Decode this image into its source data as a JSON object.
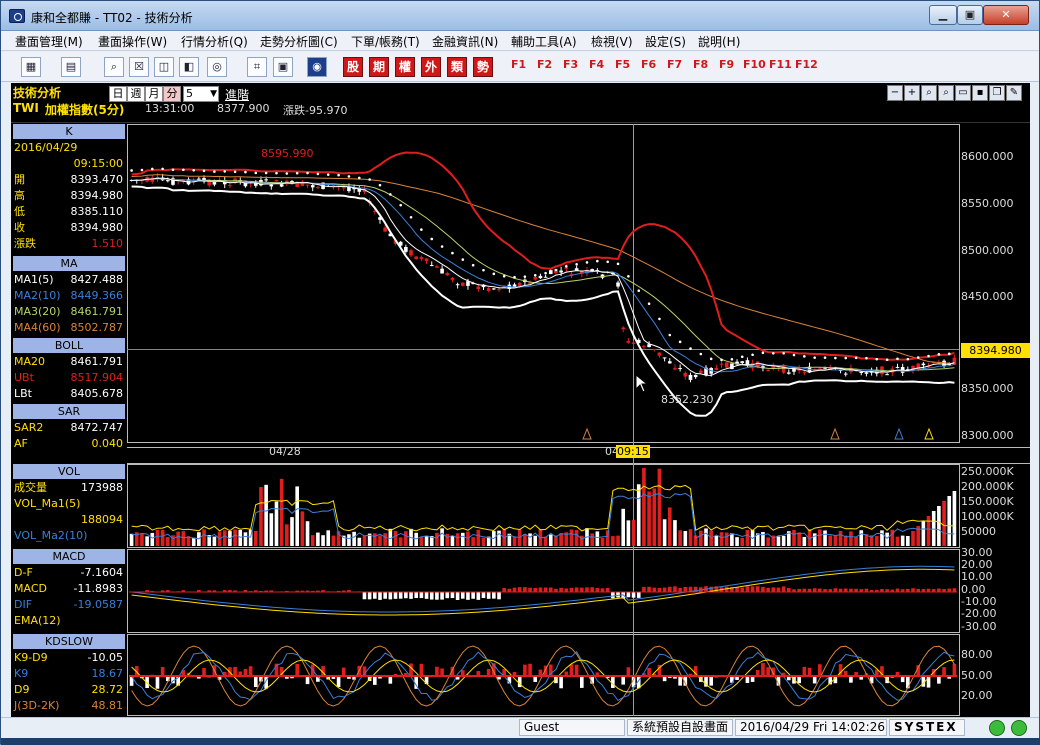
{
  "window": {
    "title": "康和全都賺 - TT02 - 技術分析",
    "minimize": "▁",
    "maximize": "▣",
    "close": "✕"
  },
  "menu": [
    "畫面管理(M)",
    "畫面操作(W)",
    "行情分析(Q)",
    "走勢分析圖(C)",
    "下單/帳務(T)",
    "金融資訊(N)",
    "輔助工具(A)",
    "檢視(V)",
    "設定(S)",
    "說明(H)"
  ],
  "toolbar": {
    "icons": [
      "layout-icon",
      "monitor-icon",
      "zoom-icon",
      "close-box-icon",
      "window-icon",
      "split-icon",
      "globe-icon",
      "link-icon",
      "screen-icon",
      "systex-icon"
    ],
    "red_buttons": [
      "股",
      "期",
      "權",
      "外",
      "類",
      "勢"
    ],
    "function_keys": [
      "F1",
      "F2",
      "F3",
      "F4",
      "F5",
      "F6",
      "F7",
      "F8",
      "F9",
      "F10",
      "F11",
      "F12"
    ]
  },
  "chart_header": {
    "section": "技術分析",
    "periods": [
      "日",
      "週",
      "月",
      "分"
    ],
    "active_period": "分",
    "interval": "5",
    "advanced": "進階",
    "symbol_code": "TWI",
    "symbol_name": "加權指數(5分)",
    "time": "13:31:00",
    "price": "8377.900",
    "change": "漲跌-95.970"
  },
  "side_panels": {
    "k": {
      "title": "K",
      "date": "2016/04/29",
      "time": "09:15:00",
      "rows": [
        {
          "k": "開",
          "v": "8393.470"
        },
        {
          "k": "高",
          "v": "8394.980"
        },
        {
          "k": "低",
          "v": "8385.110"
        },
        {
          "k": "收",
          "v": "8394.980"
        },
        {
          "k": "漲跌",
          "v": "1.510"
        }
      ]
    },
    "ma": {
      "title": "MA",
      "rows": [
        {
          "k": "MA1(5)",
          "v": "8427.488"
        },
        {
          "k": "MA2(10)",
          "v": "8449.366"
        },
        {
          "k": "MA3(20)",
          "v": "8461.791"
        },
        {
          "k": "MA4(60)",
          "v": "8502.787"
        }
      ]
    },
    "boll": {
      "title": "BOLL",
      "rows": [
        {
          "k": "MA20",
          "v": "8461.791"
        },
        {
          "k": "UBt",
          "v": "8517.904"
        },
        {
          "k": "LBt",
          "v": "8405.678"
        }
      ]
    },
    "sar": {
      "title": "SAR",
      "rows": [
        {
          "k": "SAR2",
          "v": "8472.747"
        },
        {
          "k": "AF",
          "v": "0.040"
        }
      ]
    },
    "vol": {
      "title": "VOL",
      "rows": [
        {
          "k": "成交量",
          "v": "173988"
        },
        {
          "k": "VOL_Ma1(5)",
          "v": ""
        },
        {
          "k": "",
          "v": "188094"
        },
        {
          "k": "VOL_Ma2(10)",
          "v": ""
        }
      ]
    },
    "macd": {
      "title": "MACD",
      "rows": [
        {
          "k": "D-F",
          "v": "-7.1604"
        },
        {
          "k": "MACD",
          "v": "-11.8983"
        },
        {
          "k": "DIF",
          "v": "-19.0587"
        },
        {
          "k": "EMA(12)",
          "v": ""
        }
      ]
    },
    "kd": {
      "title": "KDSLOW",
      "rows": [
        {
          "k": "K9-D9",
          "v": "-10.05"
        },
        {
          "k": "K9",
          "v": "18.67"
        },
        {
          "k": "D9",
          "v": "28.72"
        },
        {
          "k": "J(3D-2K)",
          "v": "48.81"
        }
      ]
    }
  },
  "axes": {
    "price_ticks": [
      "8600.000",
      "8550.000",
      "8500.000",
      "8450.000",
      "8400.000",
      "8350.000",
      "8300.000"
    ],
    "current_price": "8394.980",
    "vol_ticks": [
      "250.000K",
      "200.000K",
      "150.000K",
      "100.000K",
      "50000"
    ],
    "macd_ticks": [
      "30.00",
      "20.00",
      "10.00",
      "0.00",
      "-10.00",
      "-20.00",
      "-30.00"
    ],
    "kd_ticks": [
      "80.00",
      "50.00",
      "20.00"
    ],
    "x_labels": [
      "04/28",
      "04",
      "09:15"
    ],
    "hi_label": "8595.990",
    "lo_label": "8352.230"
  },
  "status": {
    "user": "Guest",
    "layout": "系統預設自設畫面",
    "datetime": "2016/04/29 Fri 14:02:26",
    "brand": "SYSTEX"
  },
  "colors": {
    "bg": "#000000",
    "up": "#e01e1e",
    "down": "#ffffff",
    "boll_upper": "#e01e1e",
    "boll_lower": "#ffffff",
    "ma5": "#ffffff",
    "ma10": "#3a7fd9",
    "ma20": "#b7d36a",
    "ma60": "#d8843a",
    "accent": "#ffe000"
  }
}
